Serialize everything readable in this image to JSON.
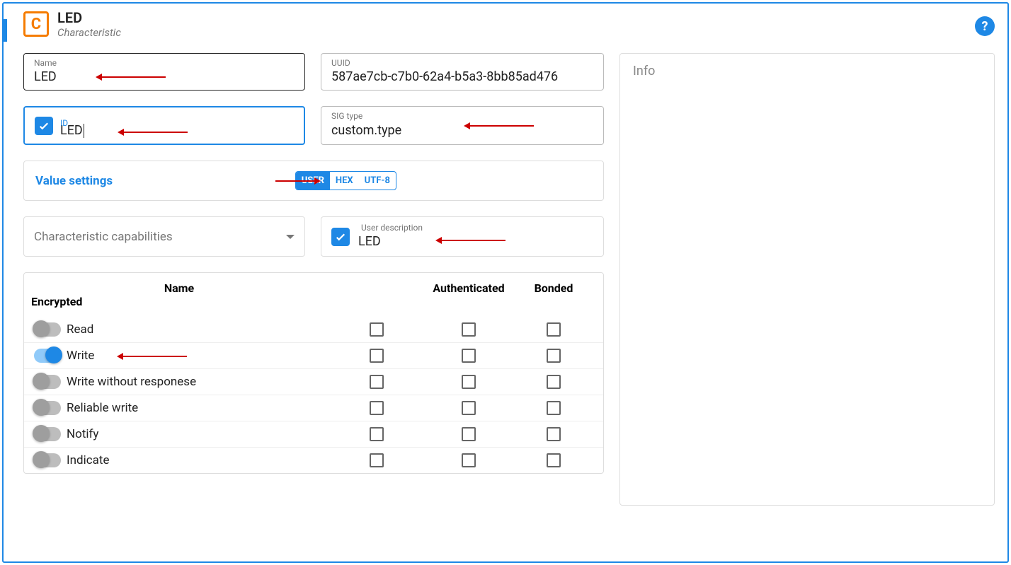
{
  "header": {
    "icon_letter": "C",
    "title": "LED",
    "subtitle": "Characteristic"
  },
  "fields": {
    "name": {
      "label": "Name",
      "value": "LED"
    },
    "uuid": {
      "label": "UUID",
      "value": "587ae7cb-c7b0-62a4-b5a3-8bb85ad476"
    },
    "id": {
      "label": "ID",
      "value": "LED",
      "checked": true
    },
    "sig": {
      "label": "SIG type",
      "value": "custom.type"
    }
  },
  "value_settings": {
    "title": "Value settings",
    "options": [
      "USER",
      "HEX",
      "UTF-8"
    ],
    "active": "USER"
  },
  "capabilities_dropdown": "Characteristic capabilities",
  "user_description": {
    "label": "User description",
    "value": "LED",
    "checked": true
  },
  "cap_table": {
    "headers": [
      "Name",
      "Authenticated",
      "Bonded",
      "Encrypted"
    ],
    "rows": [
      {
        "name": "Read",
        "on": false
      },
      {
        "name": "Write",
        "on": true
      },
      {
        "name": "Write without responese",
        "on": false
      },
      {
        "name": "Reliable write",
        "on": false
      },
      {
        "name": "Notify",
        "on": false
      },
      {
        "name": "Indicate",
        "on": false
      }
    ]
  },
  "info_panel": {
    "title": "Info"
  }
}
